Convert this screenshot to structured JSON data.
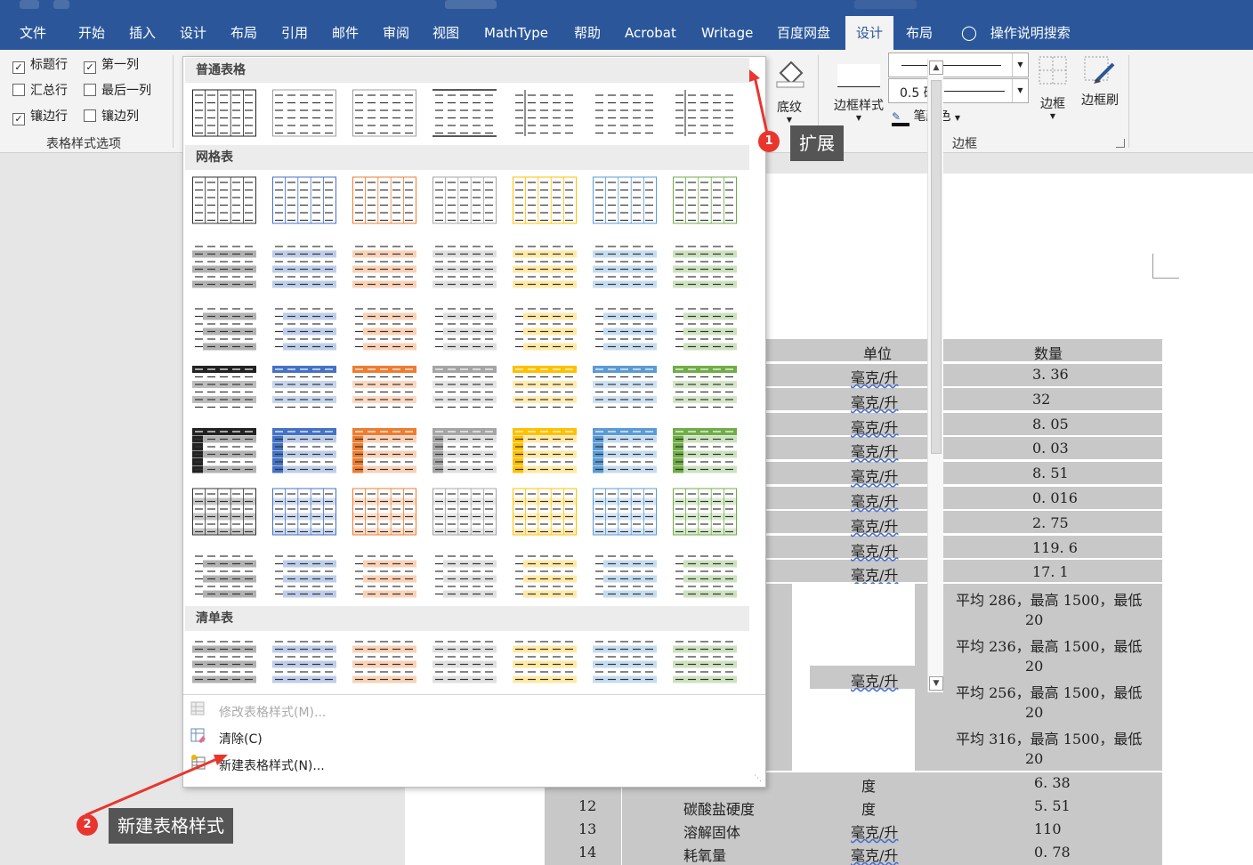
{
  "menu": {
    "tabs": [
      "文件",
      "开始",
      "插入",
      "设计",
      "布局",
      "引用",
      "邮件",
      "审阅",
      "视图",
      "MathType",
      "帮助",
      "Acrobat",
      "Writage",
      "百度网盘",
      "设计",
      "布局"
    ],
    "active_index": 14,
    "search": "操作说明搜索"
  },
  "ribbon": {
    "table_style_options": {
      "items": [
        {
          "label": "标题行",
          "checked": true
        },
        {
          "label": "第一列",
          "checked": true
        },
        {
          "label": "汇总行",
          "checked": false
        },
        {
          "label": "最后一列",
          "checked": false
        },
        {
          "label": "镶边行",
          "checked": true
        },
        {
          "label": "镶边列",
          "checked": false
        }
      ],
      "group_label": "表格样式选项"
    },
    "shading_label": "底纹",
    "border_style_label": "边框样式",
    "pen_weight": "0.5 磅",
    "pen_color_label": "笔颜色",
    "borders_label": "边框",
    "border_painter_label": "边框刷",
    "borders_group_label": "边框"
  },
  "gallery": {
    "sections": [
      {
        "title": "普通表格"
      },
      {
        "title": "网格表"
      },
      {
        "title": "清单表"
      }
    ],
    "commands": [
      {
        "label": "修改表格样式(M)...",
        "enabled": false
      },
      {
        "label": "清除(C)",
        "enabled": true
      },
      {
        "label": "新建表格样式(N)...",
        "enabled": true
      }
    ]
  },
  "annotations": [
    {
      "number": "1",
      "text": "扩展"
    },
    {
      "number": "2",
      "text": "新建表格样式"
    }
  ],
  "document": {
    "header": {
      "unit": "单位",
      "qty": "数量"
    },
    "rows": [
      {
        "unit": "毫克/升",
        "qty": "3. 36"
      },
      {
        "unit": "毫克/升",
        "qty": "32"
      },
      {
        "unit": "毫克/升",
        "qty": "8. 05"
      },
      {
        "unit": "毫克/升",
        "qty": "0. 03"
      },
      {
        "unit": "毫克/升",
        "qty": "8. 51"
      },
      {
        "unit": "毫克/升",
        "qty": "0. 016"
      },
      {
        "unit": "毫克/升",
        "qty": "2. 75"
      },
      {
        "unit": "毫克/升",
        "qty": "119. 6"
      },
      {
        "unit": "毫克/升",
        "qty": "17. 1"
      }
    ],
    "merged_unit": "毫克/升",
    "long_values": [
      {
        "line1": "平均 286，最高 1500，最低",
        "line2": "20"
      },
      {
        "line1": "平均 236，最高 1500，最低",
        "line2": "20"
      },
      {
        "line1": "平均 256，最高 1500，最低",
        "line2": "20"
      },
      {
        "line1": "平均 316，最高 1500，最低",
        "line2": "20"
      }
    ],
    "bottom_rows": [
      {
        "idx": "",
        "name": "",
        "unit": "度",
        "qty": "6. 38"
      },
      {
        "idx": "12",
        "name": "碳酸盐硬度",
        "unit": "度",
        "qty": "5. 51"
      },
      {
        "idx": "13",
        "name": "溶解固体",
        "unit": "毫克/升",
        "qty": "110"
      },
      {
        "idx": "14",
        "name": "耗氧量",
        "unit": "毫克/升",
        "qty": "0. 78"
      }
    ]
  },
  "colors": {
    "accent": "#2b579a",
    "callout_bg": "#555555",
    "badge": "#e8362e",
    "arrow": "#e8362e",
    "palette": [
      "#222222",
      "#4472c4",
      "#ed7d31",
      "#a5a5a5",
      "#ffc000",
      "#5b9bd5",
      "#70ad47"
    ]
  }
}
